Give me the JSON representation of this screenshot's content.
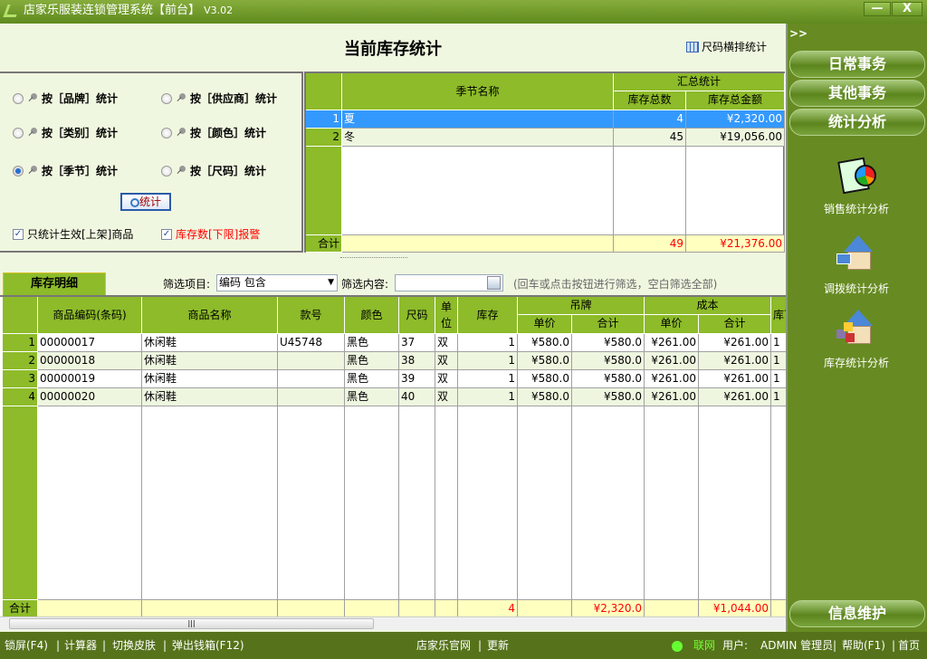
{
  "window": {
    "title": "店家乐服装连锁管理系统【前台】",
    "version": "V3.02",
    "minimize": "—",
    "close": "X"
  },
  "page": {
    "title": "当前库存统计",
    "size_layout_link": "尺码横排统计"
  },
  "options": {
    "items": [
      {
        "label": "按［品牌］统计",
        "selected": false
      },
      {
        "label": "按［供应商］统计",
        "selected": false
      },
      {
        "label": "按［类别］统计",
        "selected": false
      },
      {
        "label": "按［颜色］统计",
        "selected": false
      },
      {
        "label": "按［季节］统计",
        "selected": true
      },
      {
        "label": "按［尺码］统计",
        "selected": false
      }
    ],
    "stat_button": "统计",
    "only_active": {
      "label": "只统计生效[上架]商品",
      "checked": true
    },
    "low_stock_alert": {
      "label": "库存数[下限]报警",
      "checked": true
    }
  },
  "summary_grid": {
    "col_name": "季节名称",
    "group": "汇总统计",
    "col_qty": "库存总数",
    "col_amount": "库存总金额",
    "rows": [
      {
        "n": "1",
        "name": "夏",
        "qty": "4",
        "amount": "¥2,320.00"
      },
      {
        "n": "2",
        "name": "冬",
        "qty": "45",
        "amount": "¥19,056.00"
      }
    ],
    "total_label": "合计",
    "total_qty": "49",
    "total_amount": "¥21,376.00"
  },
  "detail": {
    "tab": "库存明细",
    "filter_label": "筛选项目:",
    "filter_value": "编码 包含",
    "content_label": "筛选内容:",
    "content_value": "",
    "hint": "(回车或点击按钮进行筛选，空白筛选全部)",
    "headers": {
      "code": "商品编码(条码)",
      "name": "商品名称",
      "style": "款号",
      "color": "颜色",
      "size": "尺码",
      "unit": "单位",
      "stock": "库存",
      "tag": "吊牌",
      "cost": "成本",
      "unit_price": "单价",
      "sum": "合计",
      "more": "库下"
    },
    "rows": [
      {
        "n": "1",
        "code": "00000017",
        "name": "休闲鞋",
        "style": "U45748",
        "color": "黑色",
        "size": "37",
        "unit": "双",
        "stock": "1",
        "tag_price": "¥580.0",
        "tag_sum": "¥580.0",
        "cost_price": "¥261.00",
        "cost_sum": "¥261.00",
        "more": "1"
      },
      {
        "n": "2",
        "code": "00000018",
        "name": "休闲鞋",
        "style": "",
        "color": "黑色",
        "size": "38",
        "unit": "双",
        "stock": "1",
        "tag_price": "¥580.0",
        "tag_sum": "¥580.0",
        "cost_price": "¥261.00",
        "cost_sum": "¥261.00",
        "more": "1"
      },
      {
        "n": "3",
        "code": "00000019",
        "name": "休闲鞋",
        "style": "",
        "color": "黑色",
        "size": "39",
        "unit": "双",
        "stock": "1",
        "tag_price": "¥580.0",
        "tag_sum": "¥580.0",
        "cost_price": "¥261.00",
        "cost_sum": "¥261.00",
        "more": "1"
      },
      {
        "n": "4",
        "code": "00000020",
        "name": "休闲鞋",
        "style": "",
        "color": "黑色",
        "size": "40",
        "unit": "双",
        "stock": "1",
        "tag_price": "¥580.0",
        "tag_sum": "¥580.0",
        "cost_price": "¥261.00",
        "cost_sum": "¥261.00",
        "more": "1"
      }
    ],
    "total_label": "合计",
    "total_stock": "4",
    "total_tag": "¥2,320.0",
    "total_cost": "¥1,044.00"
  },
  "sidebar": {
    "expand": ">>",
    "menus": [
      "日常事务",
      "其他事务",
      "统计分析"
    ],
    "items": [
      {
        "label": "销售统计分析",
        "icon": "chart-report-icon"
      },
      {
        "label": "调拨统计分析",
        "icon": "house-transfer-icon"
      },
      {
        "label": "库存统计分析",
        "icon": "house-stock-icon"
      }
    ],
    "bottom": "信息维护"
  },
  "status": {
    "left": [
      "锁屏(F4)",
      "计算器",
      "切换皮肤",
      "弹出钱箱(F12)"
    ],
    "center": [
      "店家乐官网",
      "更新"
    ],
    "net": "联网",
    "user_label": "用户:",
    "user": "ADMIN 管理员",
    "help": "帮助(F1)",
    "home": "首页"
  },
  "colors": {
    "header_green": "#8dbb2a",
    "selected_row": "#3399ff",
    "total_row": "#ffffc0",
    "sidebar": "#678b22"
  }
}
